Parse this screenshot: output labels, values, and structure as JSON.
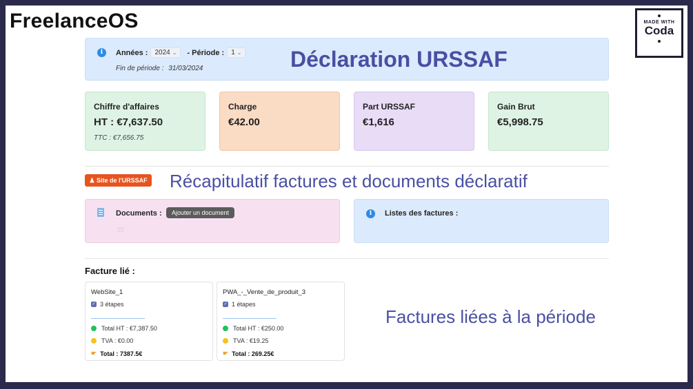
{
  "brand": "FreelanceOS",
  "badge": {
    "made_with": "MADE WITH",
    "name": "Coda"
  },
  "header": {
    "annees_label": "Années :",
    "annees_value": "2024",
    "periode_label": "- Période :",
    "periode_value": "1",
    "fin_label": "Fin de période :",
    "fin_value": "31/03/2024",
    "title": "Déclaration URSSAF"
  },
  "stats": [
    {
      "title": "Chiffre d'affaires",
      "value": "HT :  €7,637.50",
      "sub": "TTC :  €7,656.75"
    },
    {
      "title": "Charge",
      "value": "€42.00"
    },
    {
      "title": "Part URSSAF",
      "value": "€1,616"
    },
    {
      "title": "Gain Brut",
      "value": "€5,998.75"
    }
  ],
  "urssaf_button": "Site de l'URSSAF",
  "recap_title": "Récapitulatif factures et documents déclaratif",
  "documents": {
    "label": "Documents :",
    "add_button": "Ajouter un document"
  },
  "factures_list": {
    "label": "Listes des factures :"
  },
  "facture_lie_label": "Facture lié  :",
  "invoices": [
    {
      "name": "WebSite_1",
      "steps": "3 étapes",
      "total_ht": "Total HT : €7,387.50",
      "tva": "TVA : €0.00",
      "total": "Total : 7387.5€"
    },
    {
      "name": "PWA_-_Vente_de_produit_3",
      "steps": "1 étapes",
      "total_ht": "Total HT : €250.00",
      "tva": "TVA : €19.25",
      "total": "Total : 269.25€"
    }
  ],
  "period_title": "Factures liées à la période"
}
